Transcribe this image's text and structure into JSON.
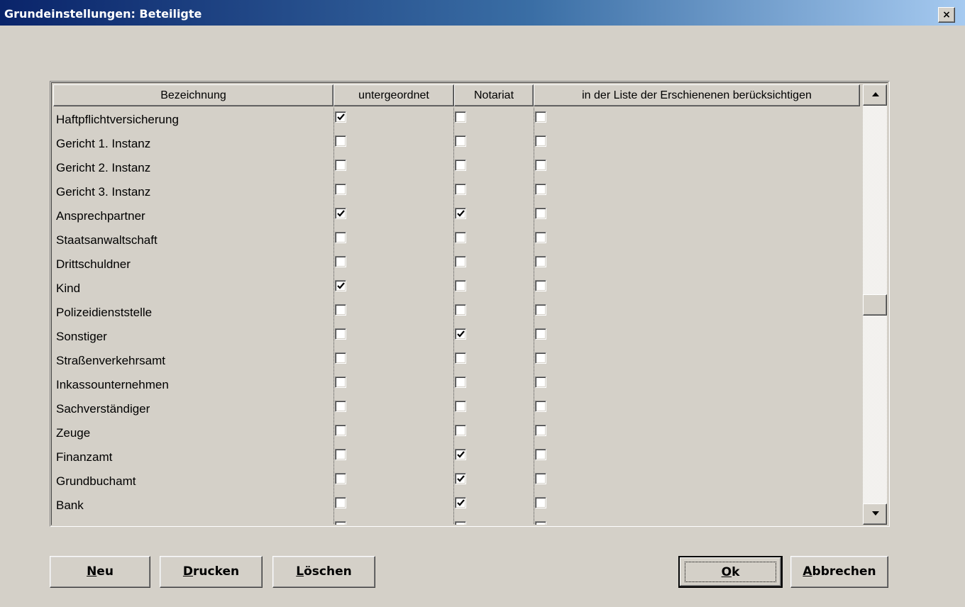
{
  "window": {
    "title": "Grundeinstellungen: Beteiligte",
    "close_label": "×"
  },
  "grid": {
    "columns": {
      "name": "Bezeichnung",
      "subordinate": "untergeordnet",
      "notary": "Notariat",
      "list": "in der Liste der Erschienenen berücksichtigen"
    },
    "rows": [
      {
        "name": "Haftpflichtversicherung",
        "subordinate": true,
        "notary": false,
        "list": false
      },
      {
        "name": "Gericht 1. Instanz",
        "subordinate": false,
        "notary": false,
        "list": false
      },
      {
        "name": "Gericht 2. Instanz",
        "subordinate": false,
        "notary": false,
        "list": false
      },
      {
        "name": "Gericht 3. Instanz",
        "subordinate": false,
        "notary": false,
        "list": false
      },
      {
        "name": "Ansprechpartner",
        "subordinate": true,
        "notary": true,
        "list": false
      },
      {
        "name": "Staatsanwaltschaft",
        "subordinate": false,
        "notary": false,
        "list": false
      },
      {
        "name": "Drittschuldner",
        "subordinate": false,
        "notary": false,
        "list": false
      },
      {
        "name": "Kind",
        "subordinate": true,
        "notary": false,
        "list": false
      },
      {
        "name": "Polizeidienststelle",
        "subordinate": false,
        "notary": false,
        "list": false
      },
      {
        "name": "Sonstiger",
        "subordinate": false,
        "notary": true,
        "list": false
      },
      {
        "name": "Straßenverkehrsamt",
        "subordinate": false,
        "notary": false,
        "list": false
      },
      {
        "name": "Inkassounternehmen",
        "subordinate": false,
        "notary": false,
        "list": false
      },
      {
        "name": "Sachverständiger",
        "subordinate": false,
        "notary": false,
        "list": false
      },
      {
        "name": "Zeuge",
        "subordinate": false,
        "notary": false,
        "list": false
      },
      {
        "name": "Finanzamt",
        "subordinate": false,
        "notary": true,
        "list": false
      },
      {
        "name": "Grundbuchamt",
        "subordinate": false,
        "notary": true,
        "list": false
      },
      {
        "name": "Bank",
        "subordinate": false,
        "notary": true,
        "list": false
      },
      {
        "name": "Käufer",
        "subordinate": false,
        "notary": false,
        "list": false
      }
    ],
    "scroll_position": 0.5
  },
  "buttons": {
    "new": {
      "accel": "N",
      "rest": "eu"
    },
    "print": {
      "accel": "D",
      "rest": "rucken"
    },
    "delete": {
      "accel": "L",
      "rest": "öschen"
    },
    "ok": {
      "accel": "O",
      "rest": "k"
    },
    "cancel": {
      "accel": "A",
      "rest": "bbrechen"
    }
  },
  "icons": {
    "close": "close-icon",
    "check": "checkmark-icon",
    "scroll_up": "arrow-up-icon",
    "scroll_down": "arrow-down-icon"
  }
}
